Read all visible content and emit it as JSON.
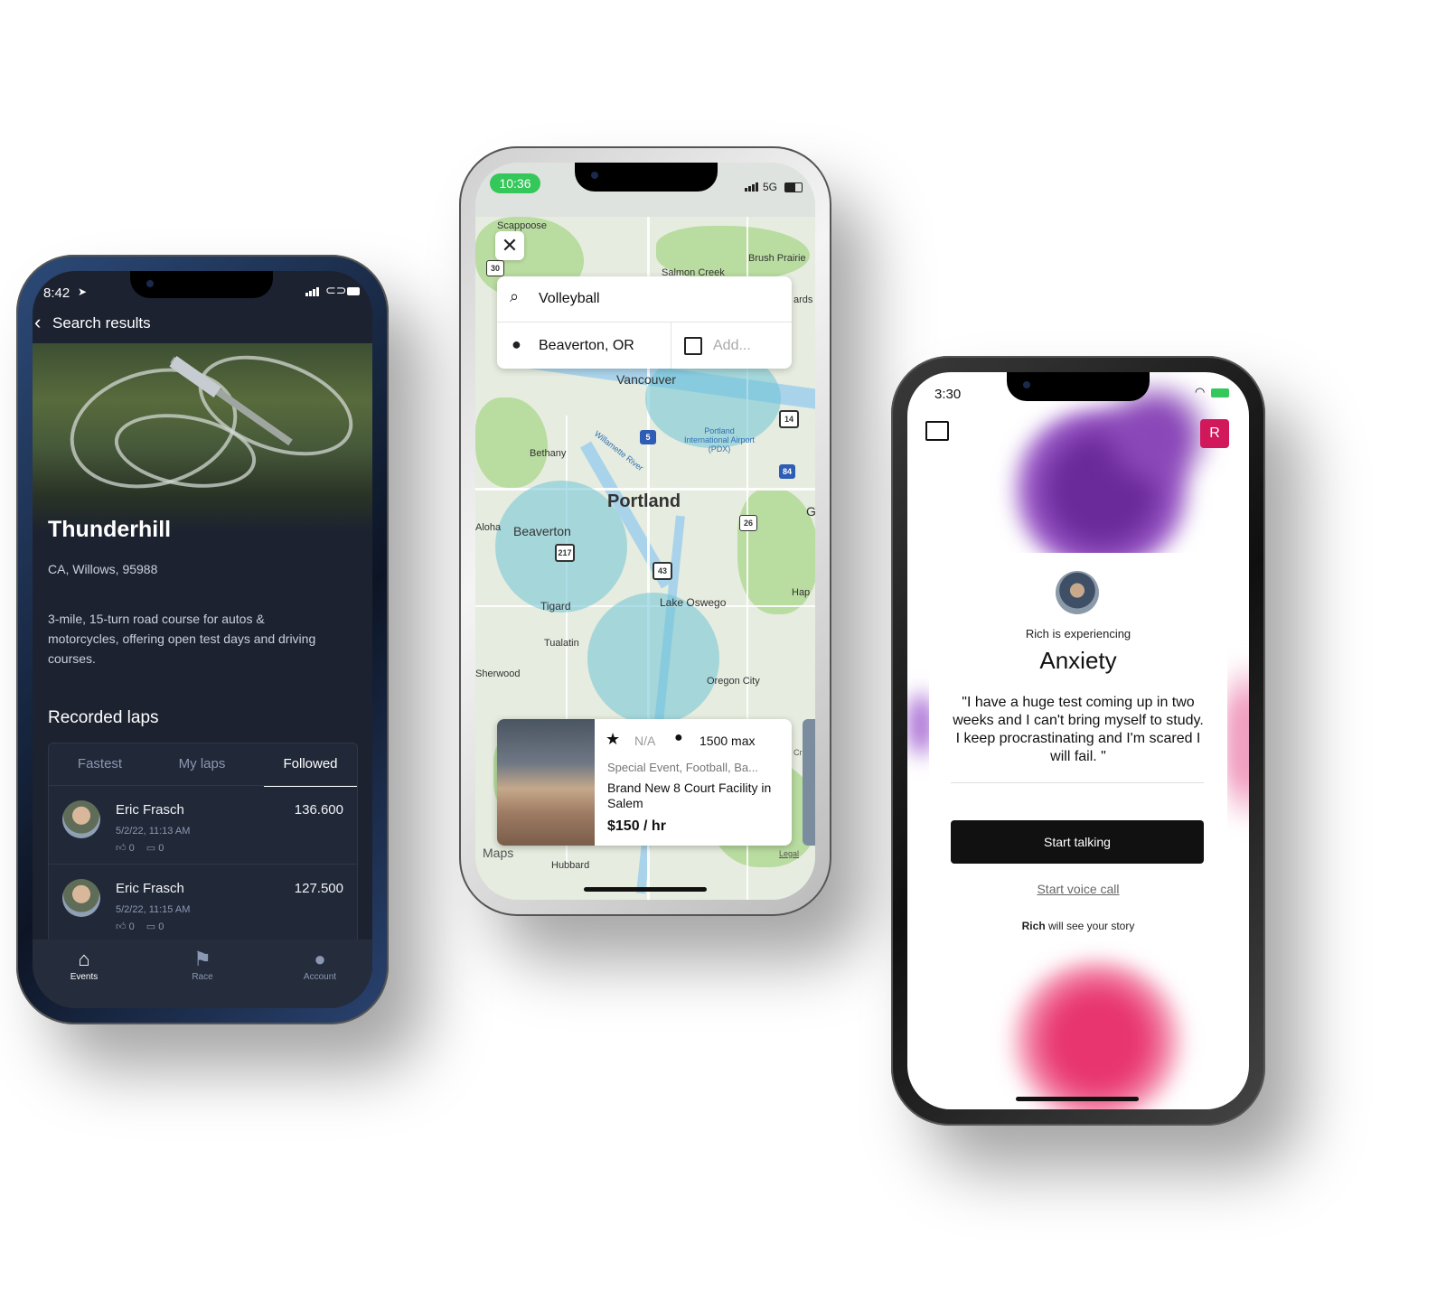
{
  "phone1": {
    "status_time": "8:42",
    "back_label": "Search results",
    "track_name": "Thunderhill",
    "location": "CA, Willows, 95988",
    "description": "3-mile, 15-turn road course for autos & motorcycles, offering open test days and driving courses.",
    "section_title": "Recorded laps",
    "tabs": [
      "Fastest",
      "My laps",
      "Followed"
    ],
    "active_tab": "Followed",
    "laps": [
      {
        "name": "Eric Frasch",
        "date": "5/2/22, 11:13 AM",
        "score": "136.600",
        "likes": "0",
        "comments": "0"
      },
      {
        "name": "Eric Frasch",
        "date": "5/2/22, 11:15 AM",
        "score": "127.500",
        "likes": "0",
        "comments": "0"
      }
    ],
    "nav": [
      {
        "label": "Events",
        "icon": "home-icon"
      },
      {
        "label": "Race",
        "icon": "checkered-flag-icon"
      },
      {
        "label": "Account",
        "icon": "person-icon"
      }
    ]
  },
  "phone2": {
    "status_time": "10:36",
    "network": "5G",
    "search_query": "Volleyball",
    "location_value": "Beaverton, OR",
    "date_placeholder": "Add...",
    "map_labels": {
      "scappoose": "Scappoose",
      "salmon_creek": "Salmon Creek",
      "brush_prairie": "Brush Prairie",
      "ards": "ards",
      "vancouver": "Vancouver",
      "airport": "Portland International Airport (PDX)",
      "bethany": "Bethany",
      "willamette": "Willamette River",
      "portland": "Portland",
      "aloha": "Aloha",
      "beaverton": "Beaverton",
      "tigard": "Tigard",
      "lake_oswego": "Lake Oswego",
      "hap": "Hap",
      "tualatin": "Tualatin",
      "sherwood": "Sherwood",
      "oregon_city": "Oregon City",
      "hubbard": "Hubbard",
      "g": "G",
      "cr": "Cr"
    },
    "shields": [
      "30",
      "5",
      "84",
      "14",
      "26",
      "217",
      "43"
    ],
    "listing": {
      "rating": "N/A",
      "capacity": "1500 max",
      "tags": "Special Event, Football, Ba...",
      "title": "Brand New 8 Court Facility in Salem",
      "price": "$150 / hr"
    },
    "maps_attribution": "Maps",
    "legal": "Legal"
  },
  "phone3": {
    "status_time": "3:30",
    "avatar_initial": "R",
    "experiencing_label": "Rich is experiencing",
    "feeling": "Anxiety",
    "quote": "\"I have a huge test coming up in two weeks and I can't bring myself to study. I keep procrastinating and I'm scared I will fail. \"",
    "primary_button": "Start talking",
    "secondary_link": "Start voice call",
    "footer_name": "Rich",
    "footer_text": " will see your story"
  },
  "colors": {
    "dark_bg": "#1c2230",
    "accent_pink": "#d0185a",
    "smoke_purple": "#7a3aa8",
    "smoke_pink": "#ec5c8c",
    "map_circle": "#6ec4d6",
    "status_green": "#34c759"
  }
}
